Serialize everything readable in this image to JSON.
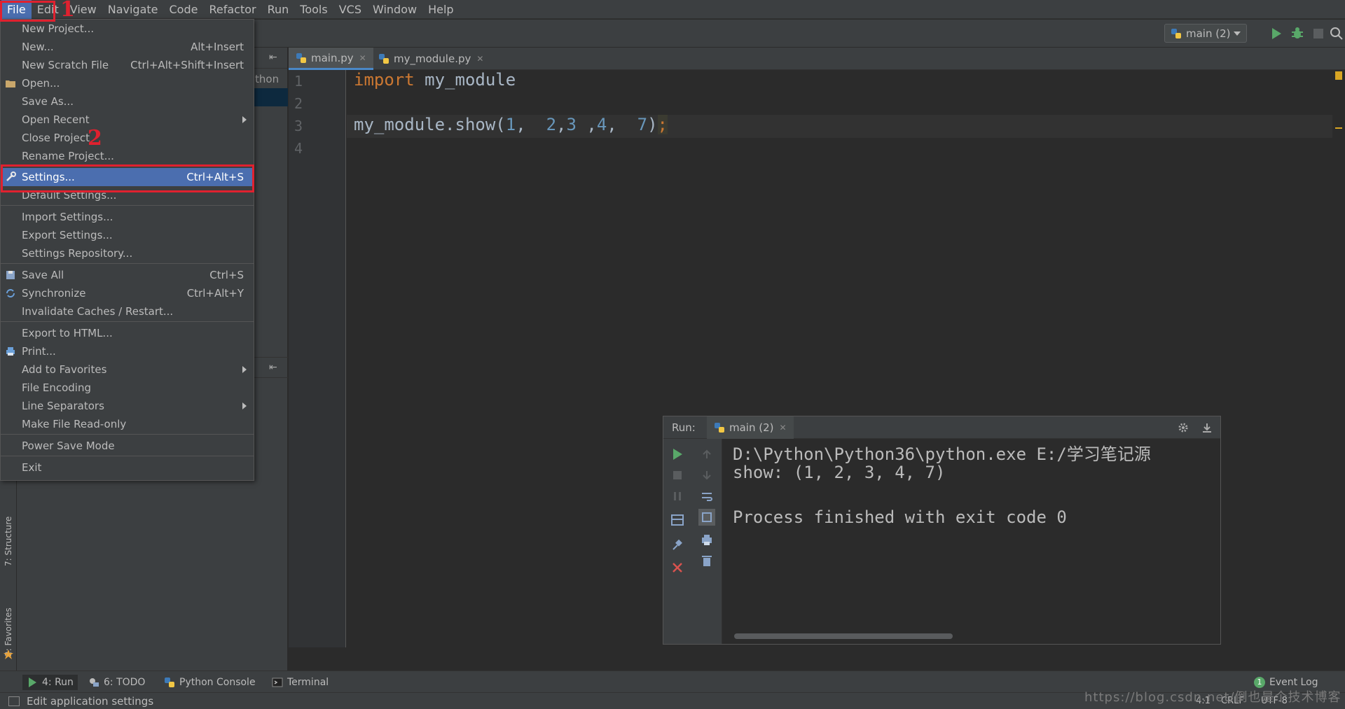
{
  "menubar": {
    "items": [
      "File",
      "Edit",
      "View",
      "Navigate",
      "Code",
      "Refactor",
      "Run",
      "Tools",
      "VCS",
      "Window",
      "Help"
    ]
  },
  "toolbar": {
    "run_config": "main (2)"
  },
  "editor": {
    "tabs": [
      {
        "label": "main.py",
        "active": true
      },
      {
        "label": "my_module.py",
        "active": false
      }
    ],
    "line_numbers": [
      "1",
      "2",
      "3",
      "4"
    ],
    "code": {
      "line1_kw": "import",
      "line1_rest": " my_module",
      "line3_a": "my_module.show(",
      "n1": "1",
      "c1": ",  ",
      "n2": "2",
      "c2": ",",
      "n3": "3",
      "c3": " ,",
      "n4": "4",
      "c4": ",  ",
      "n5": "7",
      "close": ")",
      "semi": ";"
    }
  },
  "project_panel": {
    "partial_text": "thon"
  },
  "left_strip": {
    "structure": "7: Structure",
    "favorites": "2: Favorites"
  },
  "file_menu": {
    "items": [
      {
        "label": "New Project...",
        "shortcut": ""
      },
      {
        "label": "New...",
        "shortcut": "Alt+Insert"
      },
      {
        "label": "New Scratch File",
        "shortcut": "Ctrl+Alt+Shift+Insert"
      },
      {
        "label": "Open...",
        "shortcut": ""
      },
      {
        "label": "Save As...",
        "shortcut": ""
      },
      {
        "label": "Open Recent",
        "shortcut": ""
      },
      {
        "label": "Close Project",
        "shortcut": ""
      },
      {
        "label": "Rename Project...",
        "shortcut": ""
      },
      {
        "label": "Settings...",
        "shortcut": "Ctrl+Alt+S"
      },
      {
        "label": "Default Settings...",
        "shortcut": ""
      },
      {
        "label": "Import Settings...",
        "shortcut": ""
      },
      {
        "label": "Export Settings...",
        "shortcut": ""
      },
      {
        "label": "Settings Repository...",
        "shortcut": ""
      },
      {
        "label": "Save All",
        "shortcut": "Ctrl+S"
      },
      {
        "label": "Synchronize",
        "shortcut": "Ctrl+Alt+Y"
      },
      {
        "label": "Invalidate Caches / Restart...",
        "shortcut": ""
      },
      {
        "label": "Export to HTML...",
        "shortcut": ""
      },
      {
        "label": "Print...",
        "shortcut": ""
      },
      {
        "label": "Add to Favorites",
        "shortcut": ""
      },
      {
        "label": "File Encoding",
        "shortcut": ""
      },
      {
        "label": "Line Separators",
        "shortcut": ""
      },
      {
        "label": "Make File Read-only",
        "shortcut": ""
      },
      {
        "label": "Power Save Mode",
        "shortcut": ""
      },
      {
        "label": "Exit",
        "shortcut": ""
      }
    ]
  },
  "run_window": {
    "title": "Run:",
    "tab": "main (2)",
    "console": [
      "D:\\Python\\Python36\\python.exe E:/学习笔记源",
      "show: (1, 2, 3, 4, 7)",
      "",
      "Process finished with exit code 0"
    ]
  },
  "bottom_tools": {
    "run": "4: Run",
    "todo": "6: TODO",
    "python_console": "Python Console",
    "terminal": "Terminal",
    "event_log": "Event Log",
    "event_count": "1"
  },
  "status_bar": {
    "message": "Edit application settings",
    "position": "4:1",
    "line_sep": "CRLF",
    "encoding": "UTF-8"
  },
  "annotations": {
    "num1": "1",
    "num2": "2"
  },
  "watermark": "https://blog.csdn.net/倒也是个技术博客",
  "colors": {
    "menu_selection": "#4b6eaf",
    "annotation": "#e0212f",
    "keyword": "#cc7832",
    "number": "#6897bb"
  }
}
